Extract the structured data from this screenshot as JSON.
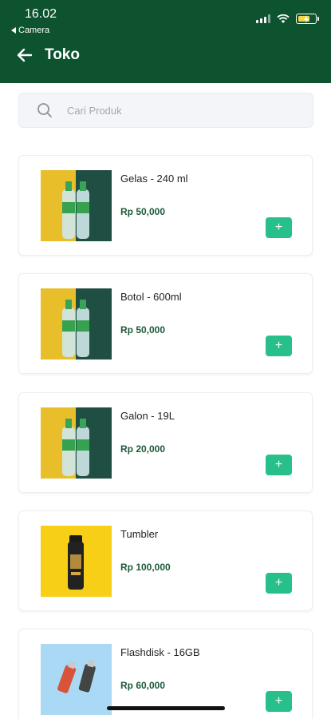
{
  "status_bar": {
    "time": "16.02",
    "back_app_label": "Camera"
  },
  "header": {
    "title": "Toko",
    "back_icon": "arrow-left-icon"
  },
  "search": {
    "placeholder": "Cari Produk",
    "value": ""
  },
  "products": [
    {
      "name": "Gelas - 240 ml",
      "price": "Rp 50,000",
      "add_label": "+",
      "image": "water-bottles"
    },
    {
      "name": "Botol - 600ml",
      "price": "Rp 50,000",
      "add_label": "+",
      "image": "water-bottles"
    },
    {
      "name": "Galon - 19L",
      "price": "Rp 20,000",
      "add_label": "+",
      "image": "water-bottles"
    },
    {
      "name": "Tumbler",
      "price": "Rp 100,000",
      "add_label": "+",
      "image": "tumbler"
    },
    {
      "name": "Flashdisk - 16GB",
      "price": "Rp 60,000",
      "add_label": "+",
      "image": "flashdisk"
    }
  ],
  "colors": {
    "header_bg": "#0d5330",
    "accent": "#27c08a",
    "price_text": "#1c5a38"
  }
}
